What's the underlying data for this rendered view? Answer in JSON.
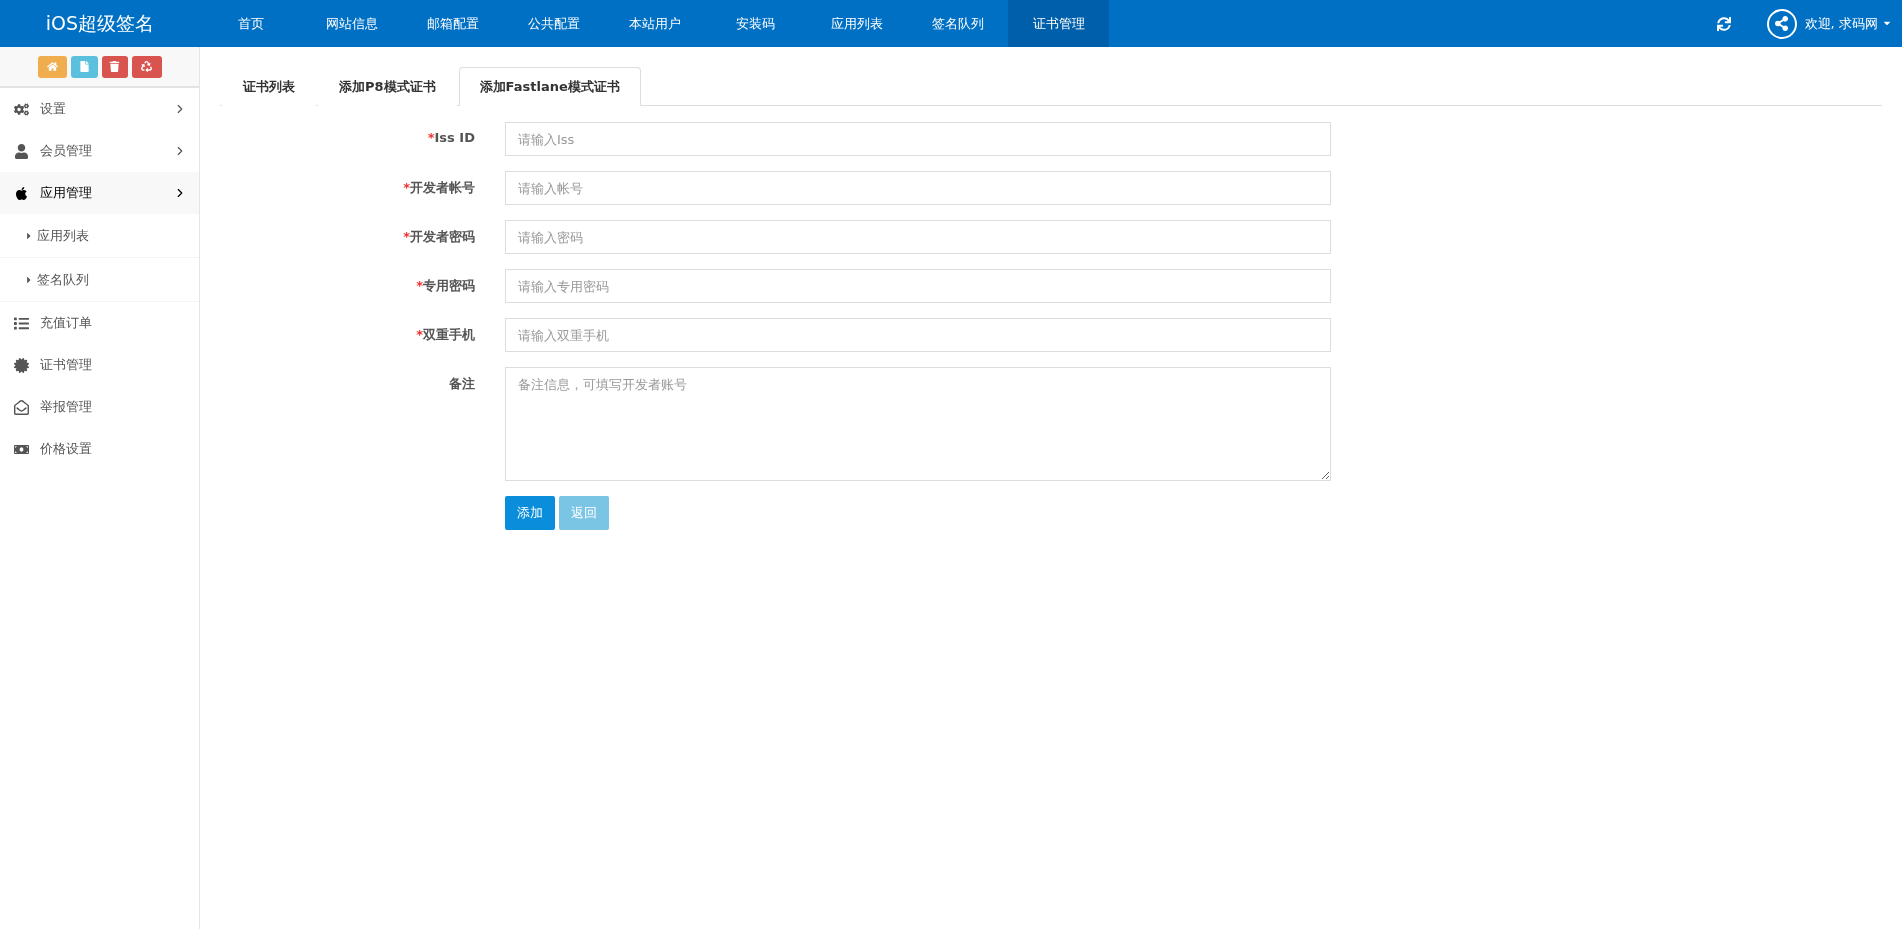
{
  "header": {
    "logo": "iOS超级签名",
    "nav": [
      {
        "label": "首页",
        "selected": false
      },
      {
        "label": "网站信息",
        "selected": false
      },
      {
        "label": "邮箱配置",
        "selected": false
      },
      {
        "label": "公共配置",
        "selected": false
      },
      {
        "label": "本站用户",
        "selected": false
      },
      {
        "label": "安装码",
        "selected": false
      },
      {
        "label": "应用列表",
        "selected": false
      },
      {
        "label": "签名队列",
        "selected": false
      },
      {
        "label": "证书管理",
        "selected": true
      }
    ],
    "user": "欢迎, 求码网"
  },
  "sidebar": {
    "toolbar": [
      {
        "color": "#f0ad4e"
      },
      {
        "color": "#5bc0de"
      },
      {
        "color": "#d9534f"
      },
      {
        "color": "#d9534f"
      }
    ],
    "items": [
      {
        "label": "设置",
        "kind": "group",
        "expanded": false
      },
      {
        "label": "会员管理",
        "kind": "group",
        "expanded": false
      },
      {
        "label": "应用管理",
        "kind": "group",
        "expanded": true,
        "children": [
          {
            "label": "应用列表"
          },
          {
            "label": "签名队列"
          }
        ]
      },
      {
        "label": "充值订单",
        "kind": "link"
      },
      {
        "label": "证书管理",
        "kind": "link"
      },
      {
        "label": "举报管理",
        "kind": "link"
      },
      {
        "label": "价格设置",
        "kind": "link"
      }
    ]
  },
  "tabs": [
    {
      "label": "证书列表",
      "selected": false
    },
    {
      "label": "添加P8模式证书",
      "selected": false
    },
    {
      "label": "添加Fastlane模式证书",
      "selected": true
    }
  ],
  "form": {
    "fields": [
      {
        "label": "Iss ID",
        "marker": "*",
        "kind": "input",
        "placeholder": "请输入Iss"
      },
      {
        "label": "开发者帐号",
        "marker": "*",
        "kind": "input",
        "placeholder": "请输入帐号"
      },
      {
        "label": "开发者密码",
        "marker": "*",
        "kind": "input",
        "placeholder": "请输入密码"
      },
      {
        "label": "专用密码",
        "marker": "*",
        "kind": "input",
        "placeholder": "请输入专用密码"
      },
      {
        "label": "双重手机",
        "marker": "*",
        "kind": "input",
        "placeholder": "请输入双重手机"
      },
      {
        "label": "备注",
        "kind": "textarea",
        "placeholder": "备注信息，可填写开发者账号"
      }
    ],
    "buttons": [
      {
        "label": "添加",
        "kind": "primary"
      },
      {
        "label": "返回",
        "kind": "secondary"
      }
    ]
  }
}
